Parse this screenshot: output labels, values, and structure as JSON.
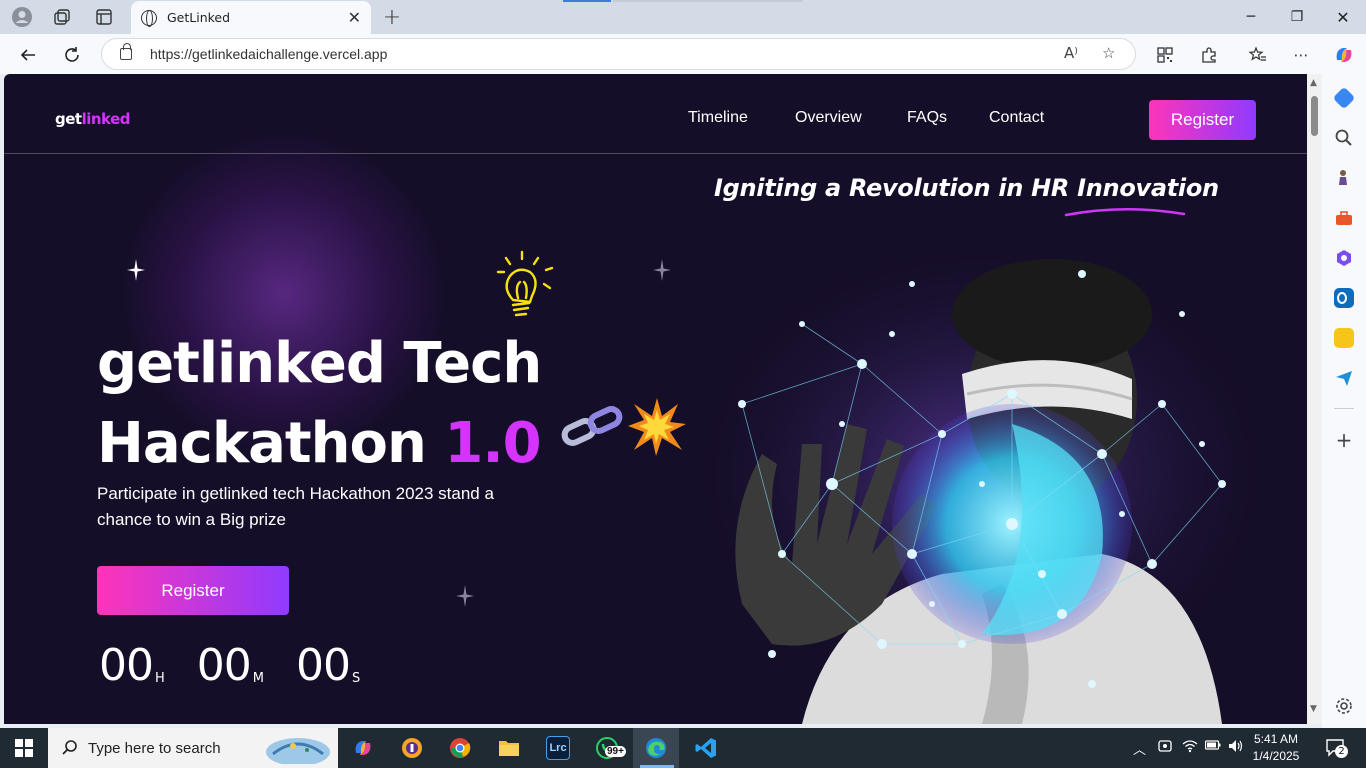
{
  "browser": {
    "tab_title": "GetLinked",
    "url": "https://getlinkedaichallenge.vercel.app"
  },
  "site": {
    "logo_main": "get",
    "logo_accent": "linked",
    "nav": [
      "Timeline",
      "Overview",
      "FAQs",
      "Contact"
    ],
    "register_label": "Register",
    "tagline": "Igniting a Revolution in HR Innovation",
    "hero_title_line1": "getlinked Tech",
    "hero_title_line2_main": "Hackathon ",
    "hero_title_line2_accent": "1.0",
    "hero_subtitle": "Participate in getlinked tech Hackathon 2023 stand a chance to win a Big prize",
    "cta_label": "Register",
    "countdown": [
      {
        "value": "00",
        "unit": "H"
      },
      {
        "value": "00",
        "unit": "M"
      },
      {
        "value": "00",
        "unit": "S"
      }
    ],
    "accent_color": "#d434fe",
    "gradient_start": "#fe34b9",
    "gradient_end": "#903aff",
    "background_color": "#150e28"
  },
  "taskbar": {
    "search_placeholder": "Type here to search",
    "whatsapp_badge": "99+",
    "time": "5:41 AM",
    "date": "1/4/2025",
    "notifications": "2",
    "lightroom_label": "Lrc"
  }
}
